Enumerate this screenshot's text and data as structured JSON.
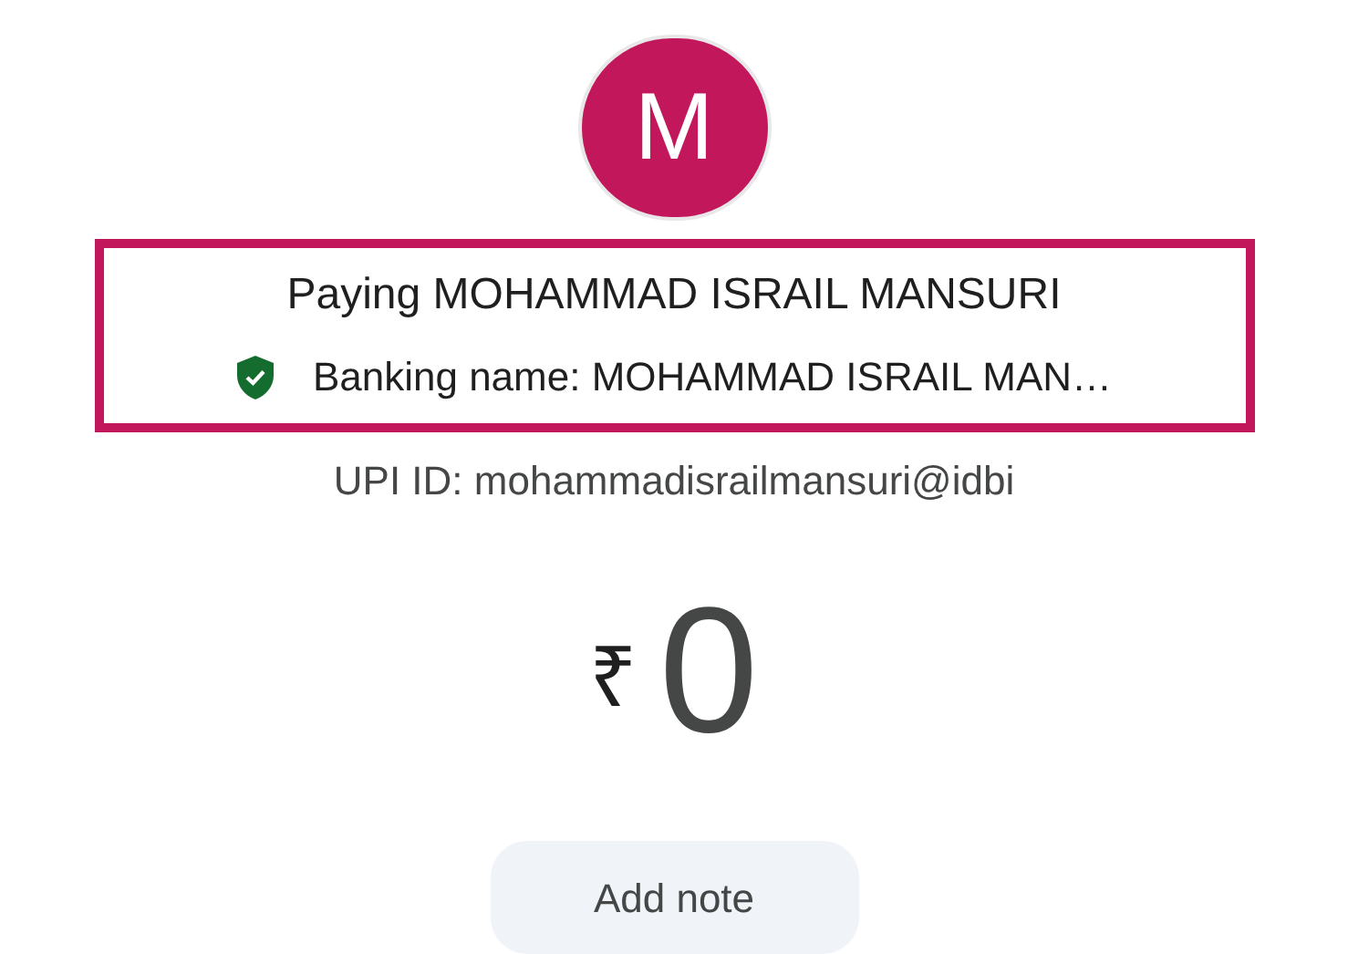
{
  "payee": {
    "initial": "M",
    "title": "Paying MOHAMMAD ISRAIL MANSURI",
    "banking_name": "Banking name: MOHAMMAD ISRAIL MAN…",
    "verified": true,
    "upi_id": "UPI ID: mohammadisrailmansuri@idbi"
  },
  "amount": {
    "currency": "₹",
    "value": "0"
  },
  "note_button": {
    "label": "Add note"
  }
}
